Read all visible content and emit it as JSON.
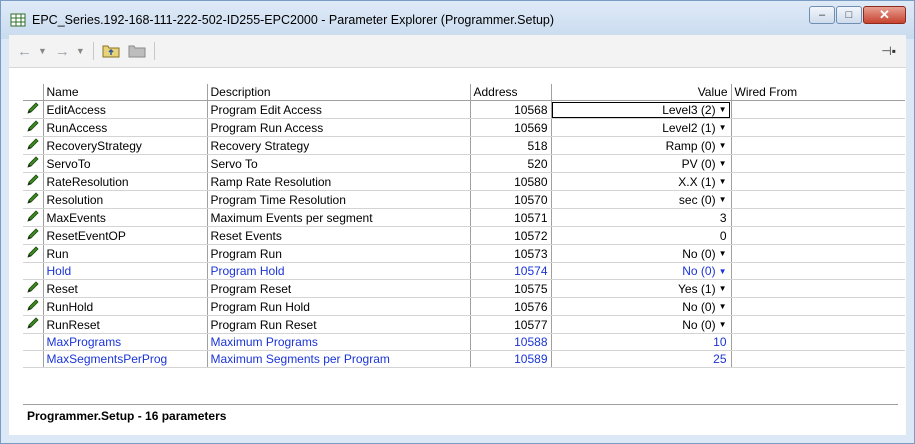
{
  "window": {
    "title": "EPC_Series.192-168-111-222-502-ID255-EPC2000 - Parameter Explorer (Programmer.Setup)",
    "minimize": "–",
    "maximize": "□",
    "close": "✕"
  },
  "toolbar": {
    "back": "←",
    "forward": "→",
    "dropdown": "▼",
    "pin": "⊣▪"
  },
  "table": {
    "columns": [
      "Name",
      "Description",
      "Address",
      "Value",
      "Wired From"
    ],
    "rows": [
      {
        "name": "EditAccess",
        "description": "Program Edit Access",
        "address": "10568",
        "value": "Level3 (2)",
        "dropdown": true,
        "editable": true,
        "blue": false
      },
      {
        "name": "RunAccess",
        "description": "Program Run Access",
        "address": "10569",
        "value": "Level2 (1)",
        "dropdown": true,
        "editable": true,
        "blue": false
      },
      {
        "name": "RecoveryStrategy",
        "description": "Recovery Strategy",
        "address": "518",
        "value": "Ramp (0)",
        "dropdown": true,
        "editable": true,
        "blue": false
      },
      {
        "name": "ServoTo",
        "description": "Servo To",
        "address": "520",
        "value": "PV (0)",
        "dropdown": true,
        "editable": true,
        "blue": false
      },
      {
        "name": "RateResolution",
        "description": "Ramp Rate Resolution",
        "address": "10580",
        "value": "X.X (1)",
        "dropdown": true,
        "editable": true,
        "blue": false
      },
      {
        "name": "Resolution",
        "description": "Program Time Resolution",
        "address": "10570",
        "value": "sec (0)",
        "dropdown": true,
        "editable": true,
        "blue": false
      },
      {
        "name": "MaxEvents",
        "description": "Maximum Events per segment",
        "address": "10571",
        "value": "3",
        "dropdown": false,
        "editable": true,
        "blue": false
      },
      {
        "name": "ResetEventOP",
        "description": "Reset Events",
        "address": "10572",
        "value": "0",
        "dropdown": false,
        "editable": true,
        "blue": false
      },
      {
        "name": "Run",
        "description": "Program Run",
        "address": "10573",
        "value": "No (0)",
        "dropdown": true,
        "editable": true,
        "blue": false
      },
      {
        "name": "Hold",
        "description": "Program Hold",
        "address": "10574",
        "value": "No (0)",
        "dropdown": true,
        "editable": false,
        "blue": true
      },
      {
        "name": "Reset",
        "description": "Program Reset",
        "address": "10575",
        "value": "Yes (1)",
        "dropdown": true,
        "editable": true,
        "blue": false
      },
      {
        "name": "RunHold",
        "description": "Program Run Hold",
        "address": "10576",
        "value": "No (0)",
        "dropdown": true,
        "editable": true,
        "blue": false
      },
      {
        "name": "RunReset",
        "description": "Program Run Reset",
        "address": "10577",
        "value": "No (0)",
        "dropdown": true,
        "editable": true,
        "blue": false
      },
      {
        "name": "MaxPrograms",
        "description": "Maximum Programs",
        "address": "10588",
        "value": "10",
        "dropdown": false,
        "editable": false,
        "blue": true
      },
      {
        "name": "MaxSegmentsPerProg",
        "description": "Maximum Segments per Program",
        "address": "10589",
        "value": "25",
        "dropdown": false,
        "editable": false,
        "blue": true
      }
    ]
  },
  "status": {
    "text": "Programmer.Setup  -  16 parameters"
  },
  "colors": {
    "blue_text": "#1a34d6",
    "pencil_green": "#3a8a1e"
  }
}
